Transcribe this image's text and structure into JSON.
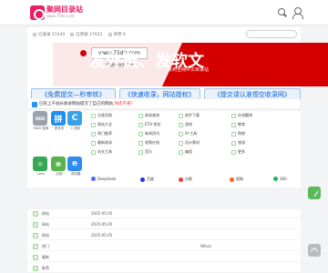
{
  "header": {
    "logo_text": "聚网目录站",
    "logo_sub": "www.75dir.com"
  },
  "stats": {
    "items": [
      "已收录 21540",
      "已审核 27621",
      "待审 0"
    ]
  },
  "banner": {
    "url": "www.75dir.com",
    "caption": "全网中文目录站",
    "title": "发外链、发软文",
    "subtitle": "就到全网中文目录站"
  },
  "promos": [
    "《免费提交—秒审核》",
    "《快速收录，网站提权》",
    "《提交请认准悟空收录网》"
  ],
  "notice": {
    "text_before": "已有上千站长收录网站提交了自己的网站,",
    "text_red": "你还不来?"
  },
  "apps": [
    {
      "label": "MDD",
      "name": "MDD 官网"
    },
    {
      "label": "拼",
      "name": "拼多多"
    },
    {
      "label": "C",
      "name": "C 语言"
    },
    {
      "label": "",
      "name": "Lens"
    },
    {
      "label": "",
      "name": "应用"
    },
    {
      "label": "e",
      "name": "浏览器"
    }
  ],
  "links": {
    "col1": [
      "分类导航",
      "网站大全",
      "热门推荐",
      "最新收录",
      "站长工具"
    ],
    "col2": [
      "收录查询",
      "ETH 钱包",
      "新闻资讯",
      "视频在线",
      "音乐"
    ],
    "col3": [
      "软件下载",
      "游戏",
      "AI 工具",
      "设计素材",
      "编程"
    ],
    "col4": [
      "在线翻译",
      "教育",
      "购物",
      "旅游",
      "更多"
    ]
  },
  "tags": [
    "DeepSeek",
    "百度",
    "谷歌",
    "搜狗",
    "360"
  ],
  "table": {
    "rows": [
      {
        "t1": "网站",
        "t2": "2025-05-05",
        "t3": "",
        "t4": "",
        "t5": ""
      },
      {
        "t1": "网站",
        "t2": "2025-05-05",
        "t3": "",
        "t4": "",
        "t5": ""
      },
      {
        "t1": "网站",
        "t2": "2025-05-05",
        "t3": "",
        "t4": "",
        "t5": ""
      },
      {
        "t1": "热门",
        "t2": "",
        "t3": "",
        "t4": "Whois",
        "t5": ""
      },
      {
        "t1": "最新",
        "t2": "",
        "t3": "",
        "t4": "",
        "t5": ""
      },
      {
        "t1": "推荐",
        "t2": "",
        "t3": "",
        "t4": "",
        "t5": ""
      }
    ]
  }
}
